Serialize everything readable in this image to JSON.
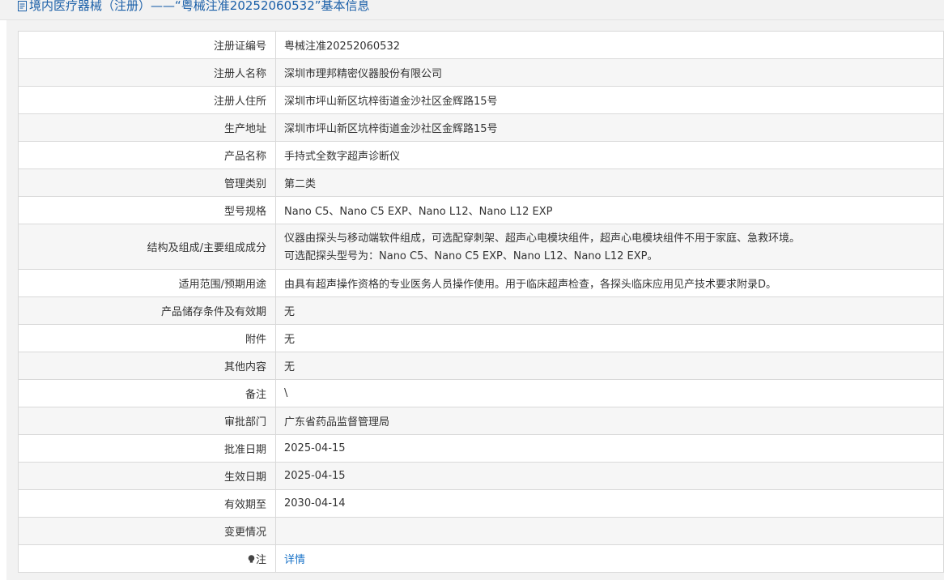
{
  "header": {
    "title": "境内医疗器械（注册）——“粤械注准20252060532”基本信息",
    "icon": "document-icon"
  },
  "rows": [
    {
      "label": "注册证编号",
      "value": "粤械注准20252060532"
    },
    {
      "label": "注册人名称",
      "value": "深圳市理邦精密仪器股份有限公司"
    },
    {
      "label": "注册人住所",
      "value": "深圳市坪山新区坑梓街道金沙社区金辉路15号"
    },
    {
      "label": "生产地址",
      "value": "深圳市坪山新区坑梓街道金沙社区金辉路15号"
    },
    {
      "label": "产品名称",
      "value": "手持式全数字超声诊断仪"
    },
    {
      "label": "管理类别",
      "value": "第二类"
    },
    {
      "label": "型号规格",
      "value": "Nano C5、Nano C5 EXP、Nano L12、Nano L12 EXP"
    }
  ],
  "structure_row": {
    "label": "结构及组成/主要组成成分",
    "line1": "仪器由探头与移动端软件组成，可选配穿刺架、超声心电模块组件，超声心电模块组件不用于家庭、急救环境。",
    "line2": "可选配探头型号为：Nano C5、Nano C5 EXP、Nano L12、Nano L12 EXP。"
  },
  "rows2": [
    {
      "label": "适用范围/预期用途",
      "value": "由具有超声操作资格的专业医务人员操作使用。用于临床超声检查，各探头临床应用见产技术要求附录D。"
    },
    {
      "label": "产品储存条件及有效期",
      "value": "无"
    },
    {
      "label": "附件",
      "value": "无"
    },
    {
      "label": "其他内容",
      "value": "无"
    },
    {
      "label": "备注",
      "value": "\\"
    },
    {
      "label": "审批部门",
      "value": "广东省药品监督管理局"
    },
    {
      "label": "批准日期",
      "value": "2025-04-15"
    },
    {
      "label": "生效日期",
      "value": "2025-04-15"
    },
    {
      "label": "有效期至",
      "value": "2030-04-14"
    },
    {
      "label": "变更情况",
      "value": ""
    }
  ],
  "note_row": {
    "label": "注",
    "icon": "lightbulb-icon",
    "link": "详情"
  }
}
